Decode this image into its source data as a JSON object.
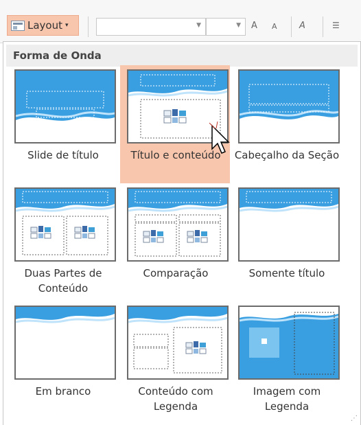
{
  "ribbon": {
    "layout_label": "Layout",
    "layout_caret": "▾",
    "font_grow": "A",
    "font_shrink": "A",
    "clear_format": "A"
  },
  "gallery": {
    "title": "Forma de Onda",
    "layouts": [
      {
        "label": "Slide de título"
      },
      {
        "label": "Título e conteúdo",
        "selected": true
      },
      {
        "label": "Cabeçalho da Seção"
      },
      {
        "label": "Duas Partes de Conteúdo"
      },
      {
        "label": "Comparação"
      },
      {
        "label": "Somente título"
      },
      {
        "label": "Em branco"
      },
      {
        "label": "Conteúdo com Legenda"
      },
      {
        "label": "Imagem com Legenda"
      }
    ]
  },
  "colors": {
    "selection": "#f8c5ad",
    "wave_blue": "#3a9fe0",
    "wave_light": "#bfe3fb"
  }
}
